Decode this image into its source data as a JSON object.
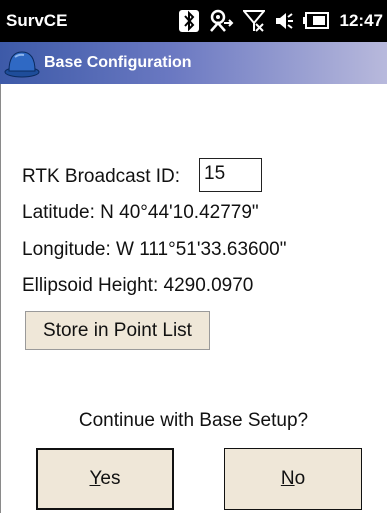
{
  "status_bar": {
    "app_name": "SurvCE",
    "time": "12:47",
    "icons": [
      "bluetooth-icon",
      "connectivity-icon",
      "signal-off-icon",
      "volume-icon",
      "battery-icon"
    ]
  },
  "window": {
    "title": "Base Configuration",
    "icon": "hard-hat-icon"
  },
  "form": {
    "rtk_label": "RTK Broadcast ID:",
    "rtk_value": "15",
    "latitude": "Latitude:  N 40°44'10.42779\"",
    "longitude": "Longitude:  W 111°51'33.63600\"",
    "ellipsoid_height": "Ellipsoid Height: 4290.0970",
    "store_button": "Store in Point List"
  },
  "dialog": {
    "prompt": "Continue with Base Setup?",
    "yes_mnemonic": "Y",
    "yes_rest": "es",
    "no_mnemonic": "N",
    "no_rest": "o"
  },
  "colors": {
    "status_bar_bg": "#000000",
    "title_gradient_start": "#3d5aa8",
    "title_gradient_end": "#b8b9dc",
    "button_bg": "#efe7d8"
  }
}
